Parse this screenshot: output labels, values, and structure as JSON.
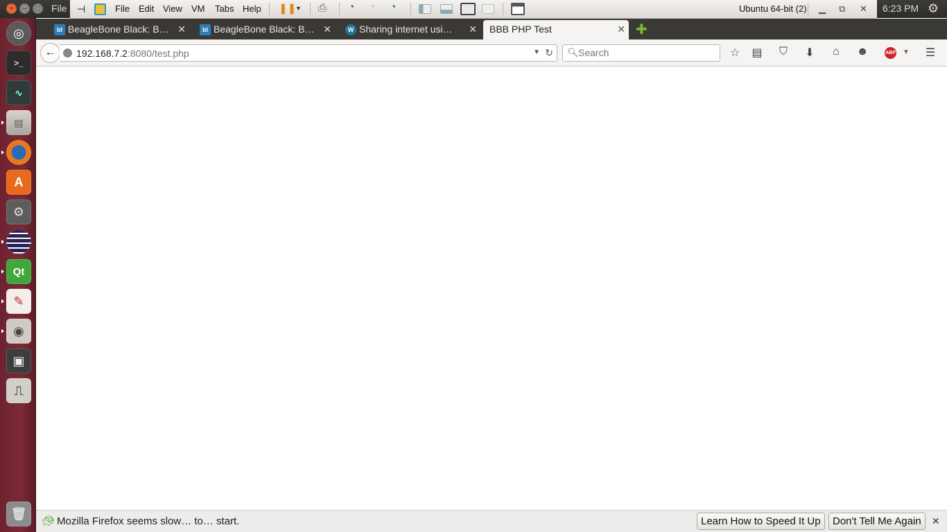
{
  "system": {
    "file_menu": "File",
    "vm_name": "Ubuntu 64-bit (2)",
    "clock": "6:23 PM",
    "vmware_menu": [
      "File",
      "Edit",
      "View",
      "VM",
      "Tabs",
      "Help"
    ]
  },
  "launcher": {
    "items": [
      "ubuntu-dash",
      "terminal",
      "system-monitor",
      "files",
      "firefox",
      "software-center",
      "system-settings",
      "eclipse",
      "qt-creator",
      "text-editor",
      "screenshot",
      "save",
      "usb-drive",
      "trash"
    ]
  },
  "browser": {
    "tabs": [
      {
        "title": "BeagleBone Black: B…",
        "favicon": "beagleboard-icon",
        "active": false
      },
      {
        "title": "BeagleBone Black: B…",
        "favicon": "beagleboard-icon",
        "active": false
      },
      {
        "title": "Sharing internet usi…",
        "favicon": "wordpress-icon",
        "active": false
      },
      {
        "title": "BBB PHP Test",
        "favicon": "",
        "active": true
      }
    ],
    "url_host": "192.168.7.2",
    "url_rest": ":8080/test.php",
    "search_placeholder": "Search"
  },
  "notification": {
    "message": "Mozilla Firefox seems slow… to… start.",
    "learn_button": "Learn How to Speed It Up",
    "dismiss_button": "Don't Tell Me Again"
  },
  "colors": {
    "launcher": "#7c2a35",
    "panel": "#3c3b37",
    "accent_orange": "#dd4814"
  }
}
